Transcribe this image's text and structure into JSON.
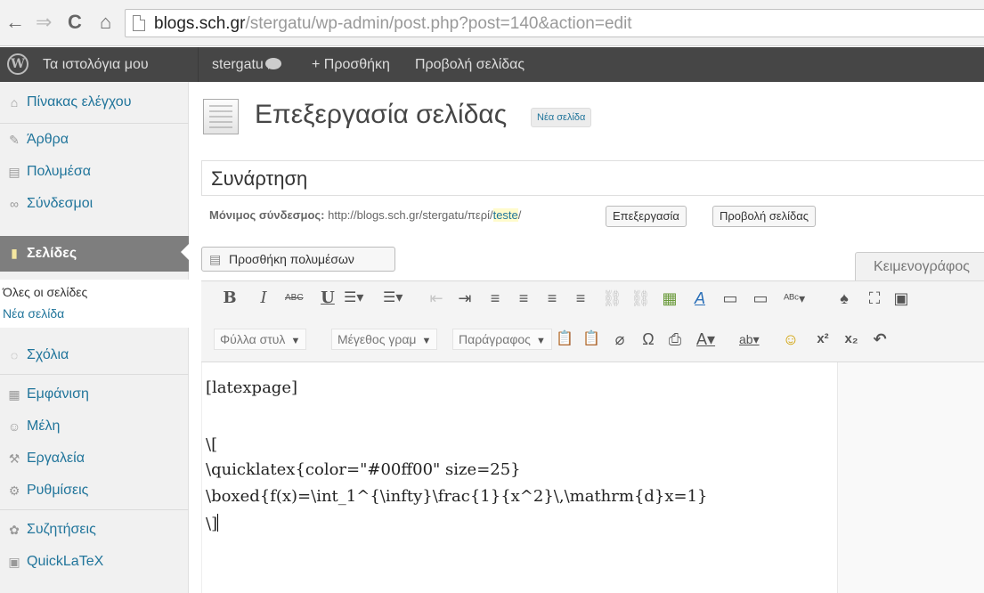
{
  "browser": {
    "url_host": "blogs.sch.gr",
    "url_path": "/stergatu/wp-admin/post.php?post=140&action=edit",
    "back_icon": "←",
    "forward_icon": "⇒",
    "reload_icon": "C",
    "home_icon": "⌂"
  },
  "adminbar": {
    "logo": "W",
    "my_blogs": "Τα ιστολόγια μου",
    "site": "stergatu",
    "add_new": "+ Προσθήκη",
    "view_page": "Προβολή σελίδας"
  },
  "sidebar": {
    "items": [
      {
        "label": "Πίνακας ελέγχου",
        "icon": "⌂"
      },
      {
        "label": "Άρθρα",
        "icon": "✎"
      },
      {
        "label": "Πολυμέσα",
        "icon": "▤"
      },
      {
        "label": "Σύνδεσμοι",
        "icon": "∞"
      },
      {
        "label": "Σελίδες",
        "icon": "▮"
      },
      {
        "label": "Σχόλια",
        "icon": "◌"
      },
      {
        "label": "Εμφάνιση",
        "icon": "▦"
      },
      {
        "label": "Μέλη",
        "icon": "☺"
      },
      {
        "label": "Εργαλεία",
        "icon": "⚒"
      },
      {
        "label": "Ρυθμίσεις",
        "icon": "⚙"
      },
      {
        "label": "Συζητήσεις",
        "icon": "✿"
      },
      {
        "label": "QuickLaTeX",
        "icon": "▣"
      }
    ],
    "submenu": {
      "all_pages": "Όλες οι σελίδες",
      "new_page": "Νέα σελίδα"
    }
  },
  "main": {
    "title": "Επεξεργασία σελίδας",
    "add_new": "Νέα σελίδα",
    "post_title": "Συνάρτηση",
    "permalink_label": "Μόνιμος σύνδεσμος:",
    "permalink_base": "http://blogs.sch.gr/stergatu/περί/",
    "permalink_slug": "teste",
    "permalink_end": "/",
    "edit_button": "Επεξεργασία",
    "view_button": "Προβολή σελίδας",
    "add_media": "Προσθήκη πολυμέσων",
    "editor_tab": "Κειμενογράφος"
  },
  "toolbar": {
    "row1": [
      "B",
      "I",
      "ABC",
      "U",
      "☰▾",
      "☰▾",
      "⇤",
      "⇥",
      "≡",
      "≡",
      "≡",
      "≡",
      "⛓",
      "⛓",
      "▦",
      "A",
      "▭",
      "▭",
      "ᴬᴮᶜ▾",
      "♠",
      "⛶",
      "▣"
    ],
    "style_select": "Φύλλα στυλ",
    "size_select": "Μέγεθος γραμ",
    "format_select": "Παράγραφος",
    "row2_icons": [
      "📋",
      "📋",
      "⌀",
      "Ω",
      "⎙",
      "A▾",
      "ab▾",
      "☺",
      "x²",
      "x₂",
      "↶"
    ]
  },
  "content": {
    "lines": [
      "[latexpage]",
      "",
      "\\[",
      "\\quicklatex{color=\"#00ff00\" size=25}",
      "\\boxed{f(x)=\\int_1^{\\infty}\\frac{1}{x^2}\\,\\mathrm{d}x=1}",
      "\\]"
    ]
  }
}
